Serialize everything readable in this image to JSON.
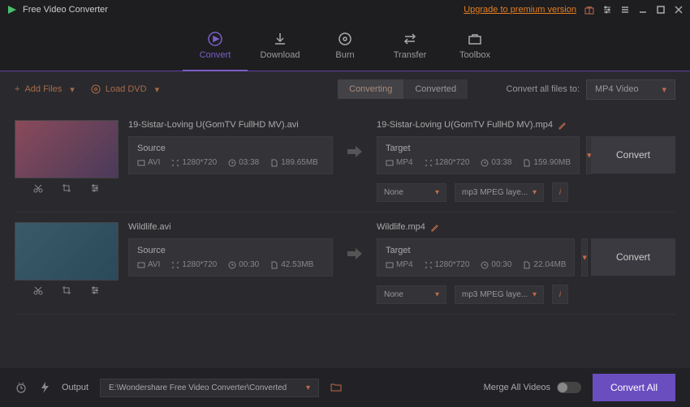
{
  "titlebar": {
    "title": "Free Video Converter",
    "upgrade": "Upgrade to premium version"
  },
  "nav": {
    "convert": "Convert",
    "download": "Download",
    "burn": "Burn",
    "transfer": "Transfer",
    "toolbox": "Toolbox"
  },
  "toolbar": {
    "add_files": "Add Files",
    "load_dvd": "Load DVD",
    "tab_converting": "Converting",
    "tab_converted": "Converted",
    "convert_all_label": "Convert all files to:",
    "format_selected": "MP4 Video"
  },
  "items": [
    {
      "source_name": "19-Sistar-Loving U(GomTV FullHD MV).avi",
      "target_name": "19-Sistar-Loving U(GomTV FullHD MV).mp4",
      "source": {
        "title": "Source",
        "fmt": "AVI",
        "res": "1280*720",
        "dur": "03:38",
        "size": "189.65MB"
      },
      "target": {
        "title": "Target",
        "fmt": "MP4",
        "res": "1280*720",
        "dur": "03:38",
        "size": "159.90MB"
      },
      "sub": "None",
      "audio": "mp3 MPEG laye...",
      "convert_btn": "Convert"
    },
    {
      "source_name": "Wildlife.avi",
      "target_name": "Wildlife.mp4",
      "source": {
        "title": "Source",
        "fmt": "AVI",
        "res": "1280*720",
        "dur": "00:30",
        "size": "42.53MB"
      },
      "target": {
        "title": "Target",
        "fmt": "MP4",
        "res": "1280*720",
        "dur": "00:30",
        "size": "22.04MB"
      },
      "sub": "None",
      "audio": "mp3 MPEG laye...",
      "convert_btn": "Convert"
    }
  ],
  "footer": {
    "output_label": "Output",
    "output_path": "E:\\Wondershare Free Video Converter\\Converted",
    "merge_label": "Merge All Videos",
    "convert_all_btn": "Convert All"
  }
}
